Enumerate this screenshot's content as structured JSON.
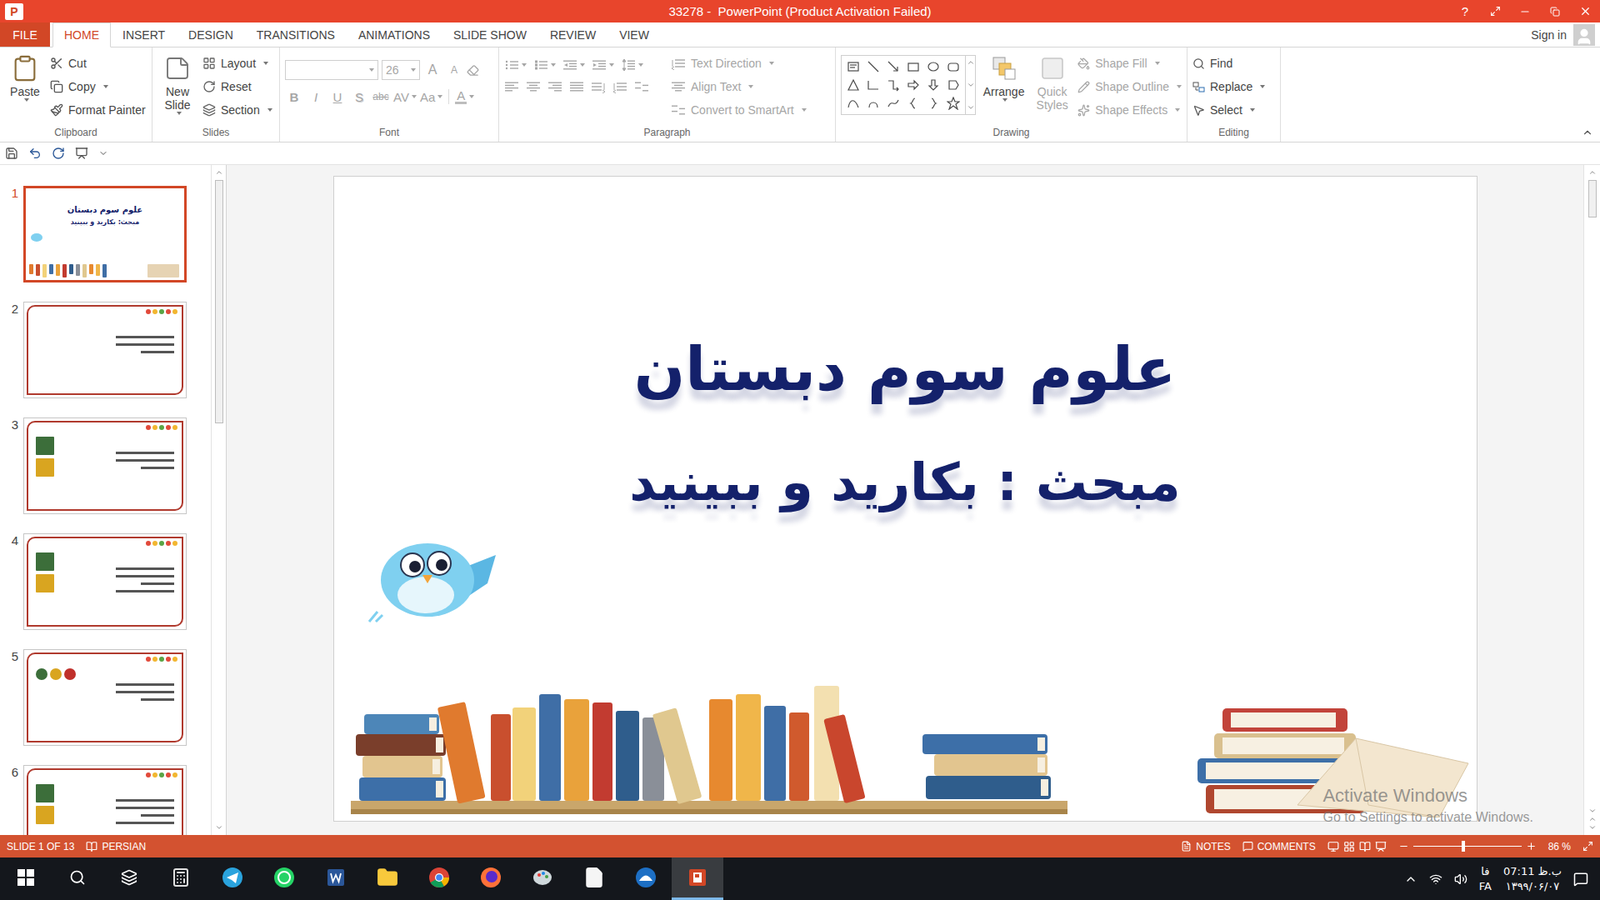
{
  "window": {
    "app_letter": "P",
    "title": "33278 -  PowerPoint (Product Activation Failed)",
    "help": "?"
  },
  "tabs": [
    {
      "label": "FILE",
      "selected": false,
      "kind": "file"
    },
    {
      "label": "HOME",
      "selected": true,
      "kind": "tab"
    },
    {
      "label": "INSERT",
      "selected": false,
      "kind": "tab"
    },
    {
      "label": "DESIGN",
      "selected": false,
      "kind": "tab"
    },
    {
      "label": "TRANSITIONS",
      "selected": false,
      "kind": "tab"
    },
    {
      "label": "ANIMATIONS",
      "selected": false,
      "kind": "tab"
    },
    {
      "label": "SLIDE SHOW",
      "selected": false,
      "kind": "tab"
    },
    {
      "label": "REVIEW",
      "selected": false,
      "kind": "tab"
    },
    {
      "label": "VIEW",
      "selected": false,
      "kind": "tab"
    }
  ],
  "account": {
    "label": "Sign in"
  },
  "ribbon": {
    "clipboard": {
      "label": "Clipboard",
      "paste": {
        "label": "Paste",
        "dropdown": true
      },
      "items": [
        {
          "label": "Cut",
          "dropdown": false
        },
        {
          "label": "Copy",
          "dropdown": true
        },
        {
          "label": "Format Painter",
          "dropdown": false
        }
      ]
    },
    "slides": {
      "label": "Slides",
      "new_slide": {
        "label": "New Slide",
        "dropdown": true
      },
      "items": [
        {
          "label": "Layout",
          "dropdown": true
        },
        {
          "label": "Reset",
          "dropdown": false
        },
        {
          "label": "Section",
          "dropdown": true
        }
      ]
    },
    "font": {
      "label": "Font",
      "disabled": true,
      "size": "26",
      "grow": "A",
      "shrink": "A",
      "styles": [
        {
          "label": "B",
          "kind": "bold",
          "dropdown": false
        },
        {
          "label": "I",
          "kind": "italic",
          "dropdown": false
        },
        {
          "label": "U",
          "kind": "underline",
          "dropdown": false
        },
        {
          "label": "S",
          "kind": "shadow",
          "dropdown": false
        },
        {
          "label": "abc",
          "kind": "strike",
          "dropdown": false
        },
        {
          "label": "AV",
          "kind": "spacing",
          "dropdown": true
        },
        {
          "label": "Aa",
          "kind": "case",
          "dropdown": true
        }
      ],
      "color_button": {
        "label": "A",
        "dropdown": true
      }
    },
    "paragraph": {
      "label": "Paragraph",
      "disabled": true,
      "commands": [
        {
          "label": "Text Direction",
          "dropdown": true
        },
        {
          "label": "Align Text",
          "dropdown": true
        },
        {
          "label": "Convert to SmartArt",
          "dropdown": true
        }
      ]
    },
    "drawing": {
      "label": "Drawing",
      "arrange": {
        "label": "Arrange",
        "disabled": false
      },
      "quick_styles": {
        "label": "Quick Styles",
        "disabled": true
      },
      "commands": [
        {
          "label": "Shape Fill",
          "disabled": true
        },
        {
          "label": "Shape Outline",
          "disabled": true
        },
        {
          "label": "Shape Effects",
          "disabled": true
        }
      ]
    },
    "editing": {
      "label": "Editing",
      "items": [
        {
          "label": "Find",
          "dropdown": false
        },
        {
          "label": "Replace",
          "dropdown": true
        },
        {
          "label": "Select",
          "dropdown": true
        }
      ]
    }
  },
  "thumbnails": [
    {
      "number": "1",
      "selected": true,
      "kind": "title",
      "title": "علوم سوم دبستان",
      "subtitle": "مبحث: بکارید و ببینید"
    },
    {
      "number": "2",
      "selected": false,
      "kind": "content",
      "pictures": 0,
      "lines": 3
    },
    {
      "number": "3",
      "selected": false,
      "kind": "content",
      "pictures": 2,
      "lines": 3
    },
    {
      "number": "4",
      "selected": false,
      "kind": "content",
      "pictures": 2,
      "lines": 4
    },
    {
      "number": "5",
      "selected": false,
      "kind": "content",
      "pictures": 3,
      "lines": 3
    },
    {
      "number": "6",
      "selected": false,
      "kind": "content",
      "pictures": 2,
      "lines": 4
    }
  ],
  "slide": {
    "title": "علوم سوم دبستان",
    "subtitle": "مبحث : بکارید و ببینید"
  },
  "watermark": {
    "title": "Activate Windows",
    "subtitle": "Go to Settings to activate Windows."
  },
  "scrollbars": {
    "thumbnails": {
      "level": 0.38
    },
    "slide": {
      "level": 0.06
    }
  },
  "status_bar": {
    "slide": "SLIDE 1 OF 13",
    "language": "PERSIAN",
    "notes": "NOTES",
    "comments": "COMMENTS",
    "zoom": "86 %",
    "zoom_level": 0.45
  },
  "taskbar": {
    "apps": [
      {
        "active": false
      },
      {
        "active": false
      },
      {
        "active": false
      },
      {
        "active": false
      },
      {
        "active": false
      },
      {
        "active": false
      },
      {
        "active": false
      },
      {
        "active": false
      },
      {
        "active": false
      },
      {
        "active": false
      },
      {
        "active": true
      }
    ],
    "ime": "فا",
    "language": "FA",
    "time": "07:11 ب.ظ",
    "date": "۱۳۹۹/۰۶/۰۷"
  }
}
